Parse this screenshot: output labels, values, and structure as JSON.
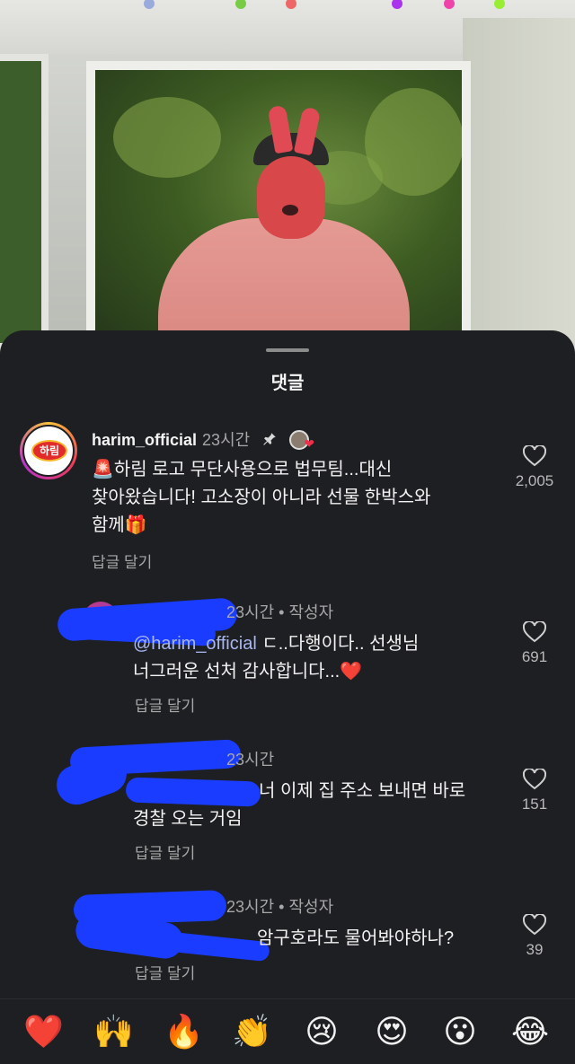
{
  "sheet": {
    "title": "댓글"
  },
  "comments": [
    {
      "username": "harim_official",
      "avatar_label": "하림",
      "time": "23시간",
      "lines": [
        "🚨하림 로고 무단사용으로 법무팀...대신",
        "찾아왔습니다! 고소장이 아니라 선물 한박스와",
        "함께🎁"
      ],
      "reply": "답글 달기",
      "likes": "2,005",
      "pinned": true,
      "liked_by_creator": true
    },
    {
      "time": "23시간",
      "author_tag": "작성자",
      "mention": "@harim_official",
      "text_after_mention": " ㄷ..다행이다.. 선생님",
      "line2": "너그러운 선처 감사합니다...❤️",
      "reply": "답글 달기",
      "likes": "691"
    },
    {
      "time": "23시간",
      "line1": "너 이제 집 주소 보내면 바로",
      "line2": "경찰 오는 거임",
      "reply": "답글 달기",
      "likes": "151"
    },
    {
      "time": "23시간",
      "author_tag": "작성자",
      "line1": "암구호라도 물어봐야하나?",
      "reply": "답글 달기",
      "likes": "39"
    }
  ],
  "emoji_bar": [
    "❤️",
    "🙌",
    "🔥",
    "👏",
    "😢",
    "😍",
    "😮",
    "😂"
  ],
  "colors": {
    "sheet_bg": "#1e1f22",
    "mention": "#a9b7f0",
    "scribble": "#1a3cff",
    "heart": "#f0304a"
  }
}
